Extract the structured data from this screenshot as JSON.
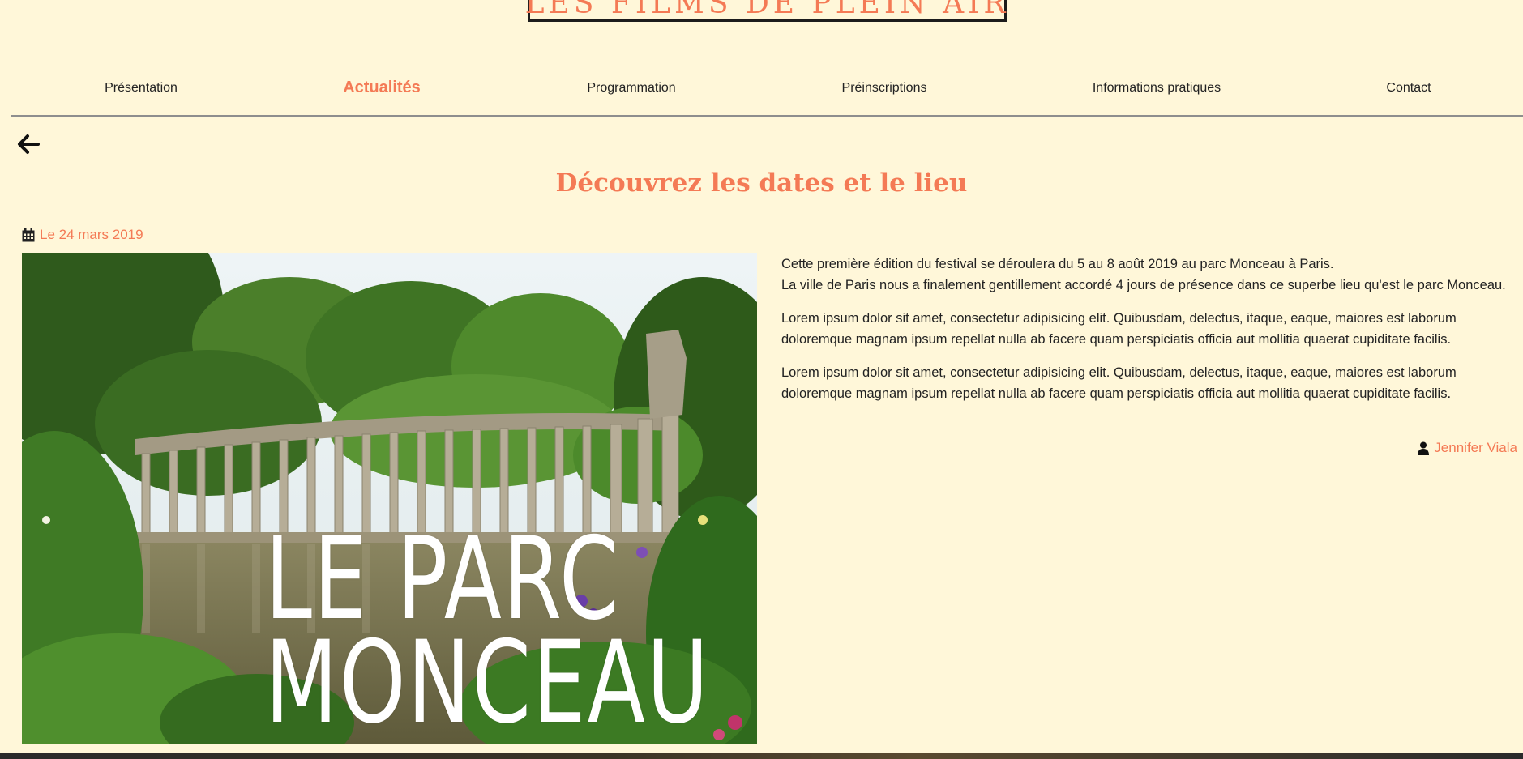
{
  "header": {
    "logo_text": "LES FILMS DE PLEIN AIR"
  },
  "nav": {
    "items": [
      {
        "label": "Présentation",
        "active": false
      },
      {
        "label": "Actualités",
        "active": true
      },
      {
        "label": "Programmation",
        "active": false
      },
      {
        "label": "Préinscriptions",
        "active": false
      },
      {
        "label": "Informations pratiques",
        "active": false
      },
      {
        "label": "Contact",
        "active": false
      }
    ]
  },
  "article": {
    "back_icon": "arrow-left-icon",
    "title": "Découvrez les dates et le lieu",
    "date_icon": "calendar-icon",
    "date": "Le 24 mars 2019",
    "image": {
      "caption_line_1": "LE PARC",
      "caption_line_2": "MONCEAU"
    },
    "paragraph_1_line_1": "Cette première édition du festival se déroulera du 5 au 8 août 2019 au parc Monceau à Paris.",
    "paragraph_1_line_2": "La ville de Paris nous a finalement gentillement accordé 4 jours de présence dans ce superbe lieu qu'est le parc Monceau.",
    "paragraph_2": "Lorem ipsum dolor sit amet, consectetur adipisicing elit. Quibusdam, delectus, itaque, eaque, maiores est laborum doloremque magnam ipsum repellat nulla ab facere quam perspiciatis officia aut mollitia quaerat cupiditate facilis.",
    "paragraph_3": "Lorem ipsum dolor sit amet, consectetur adipisicing elit. Quibusdam, delectus, itaque, eaque, maiores est laborum doloremque magnam ipsum repellat nulla ab facere quam perspiciatis officia aut mollitia quaerat cupiditate facilis.",
    "author_icon": "user-icon",
    "author": "Jennifer Viala"
  },
  "colors": {
    "accent": "#f47a55",
    "background": "#fff7d9",
    "text": "#222222"
  }
}
